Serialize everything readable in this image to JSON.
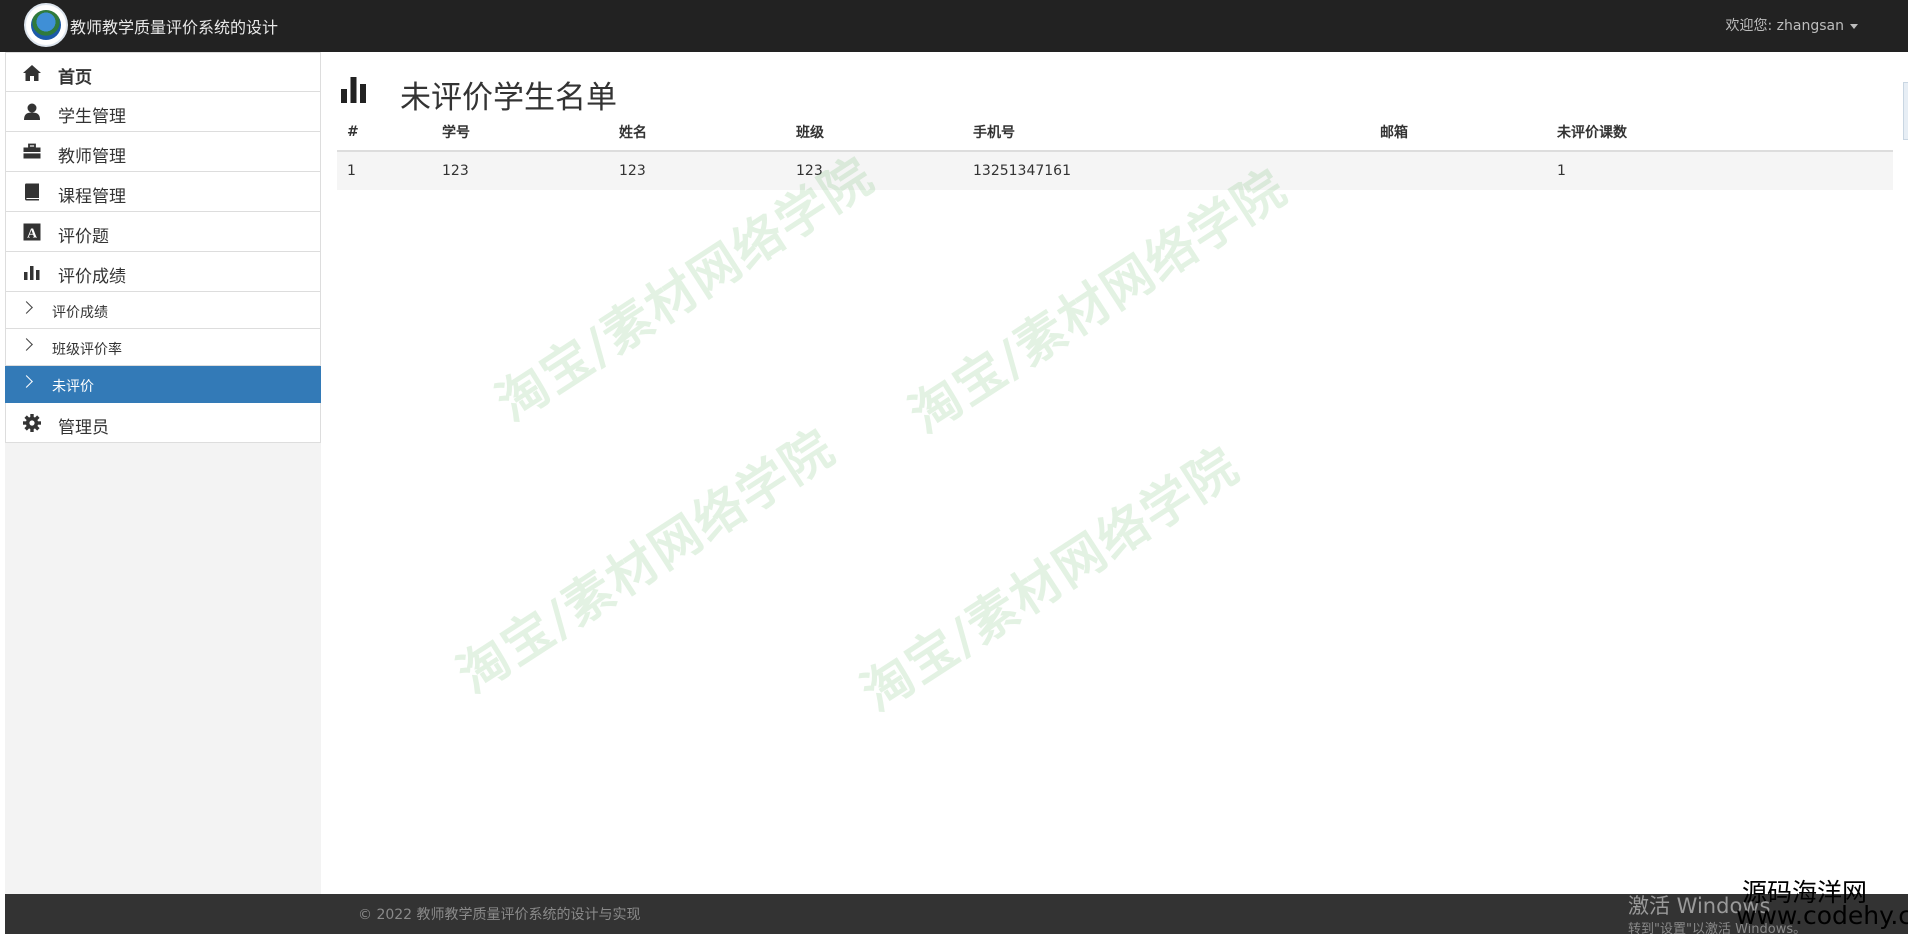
{
  "navbar": {
    "brand_title": "教师教学质量评价系统的设计",
    "user_menu": "欢迎您: zhangsan"
  },
  "sidebar": {
    "items": [
      {
        "label": "首页",
        "icon": "home-icon"
      },
      {
        "label": "学生管理",
        "icon": "user-icon"
      },
      {
        "label": "教师管理",
        "icon": "briefcase-icon"
      },
      {
        "label": "课程管理",
        "icon": "book-icon"
      },
      {
        "label": "评价题",
        "icon": "font-icon"
      },
      {
        "label": "评价成绩",
        "icon": "stats-icon"
      }
    ],
    "subitems": [
      {
        "label": "评价成绩"
      },
      {
        "label": "班级评价率"
      },
      {
        "label": "未评价",
        "active": true
      }
    ],
    "admin": {
      "label": "管理员",
      "icon": "cog-icon"
    }
  },
  "main": {
    "page_title": "未评价学生名单",
    "table": {
      "columns": [
        "#",
        "学号",
        "姓名",
        "班级",
        "手机号",
        "邮箱",
        "未评价课数"
      ],
      "rows": [
        [
          "1",
          "123",
          "123",
          "123",
          "13251347161",
          "",
          "1"
        ]
      ]
    }
  },
  "watermark": "淘宝/素材网络学院",
  "footer": {
    "copyright": "© 2022 教师教学质量评价系统的设计与实现",
    "windows_activate": "激活 Windows",
    "windows_activate_sub": "转到\"设置\"以激活 Windows。",
    "corner_logo": "源码海洋网",
    "corner_url": "www.codehy.com"
  },
  "colors": {
    "navbar_bg": "#222222",
    "active_bg": "#337ab7",
    "footer_bg": "#333333",
    "sidebar_bg": "#f3f3f3"
  }
}
